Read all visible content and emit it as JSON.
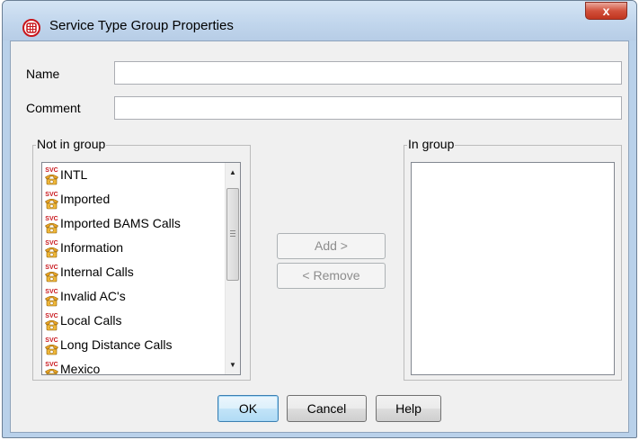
{
  "window": {
    "title": "Service Type Group Properties",
    "close_label": "x",
    "accent_color": "#c8151b"
  },
  "form": {
    "name_label": "Name",
    "name_value": "",
    "comment_label": "Comment",
    "comment_value": ""
  },
  "not_in_group": {
    "title": "Not in group",
    "icon": "svc-phone-icon",
    "items": [
      "INTL",
      "Imported",
      "Imported BAMS Calls",
      "Information",
      "Internal Calls",
      "Invalid AC's",
      "Local Calls",
      "Long Distance Calls",
      "Mexico"
    ]
  },
  "in_group": {
    "title": "In group",
    "items": []
  },
  "buttons": {
    "add": "Add >",
    "remove": "< Remove",
    "ok": "OK",
    "cancel": "Cancel",
    "help": "Help"
  }
}
